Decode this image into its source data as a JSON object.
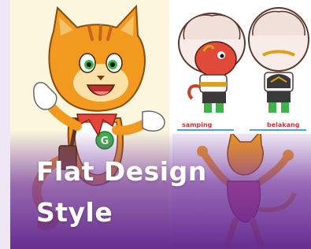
{
  "title": {
    "line1": "Flat Design",
    "line2": "Style"
  },
  "mascot": {
    "shirt_letter": "G"
  },
  "views": {
    "side_label": "samping",
    "back_label": "belakang"
  },
  "colors": {
    "overlay": "#5f238c",
    "label_red": "#d0303a",
    "cat_orange": "#f29a1f",
    "cat_green": "#3db34a"
  },
  "icons": [
    "cat-mascot-illustration",
    "costume-character-side",
    "costume-character-back",
    "dancing-cat-illustration"
  ]
}
